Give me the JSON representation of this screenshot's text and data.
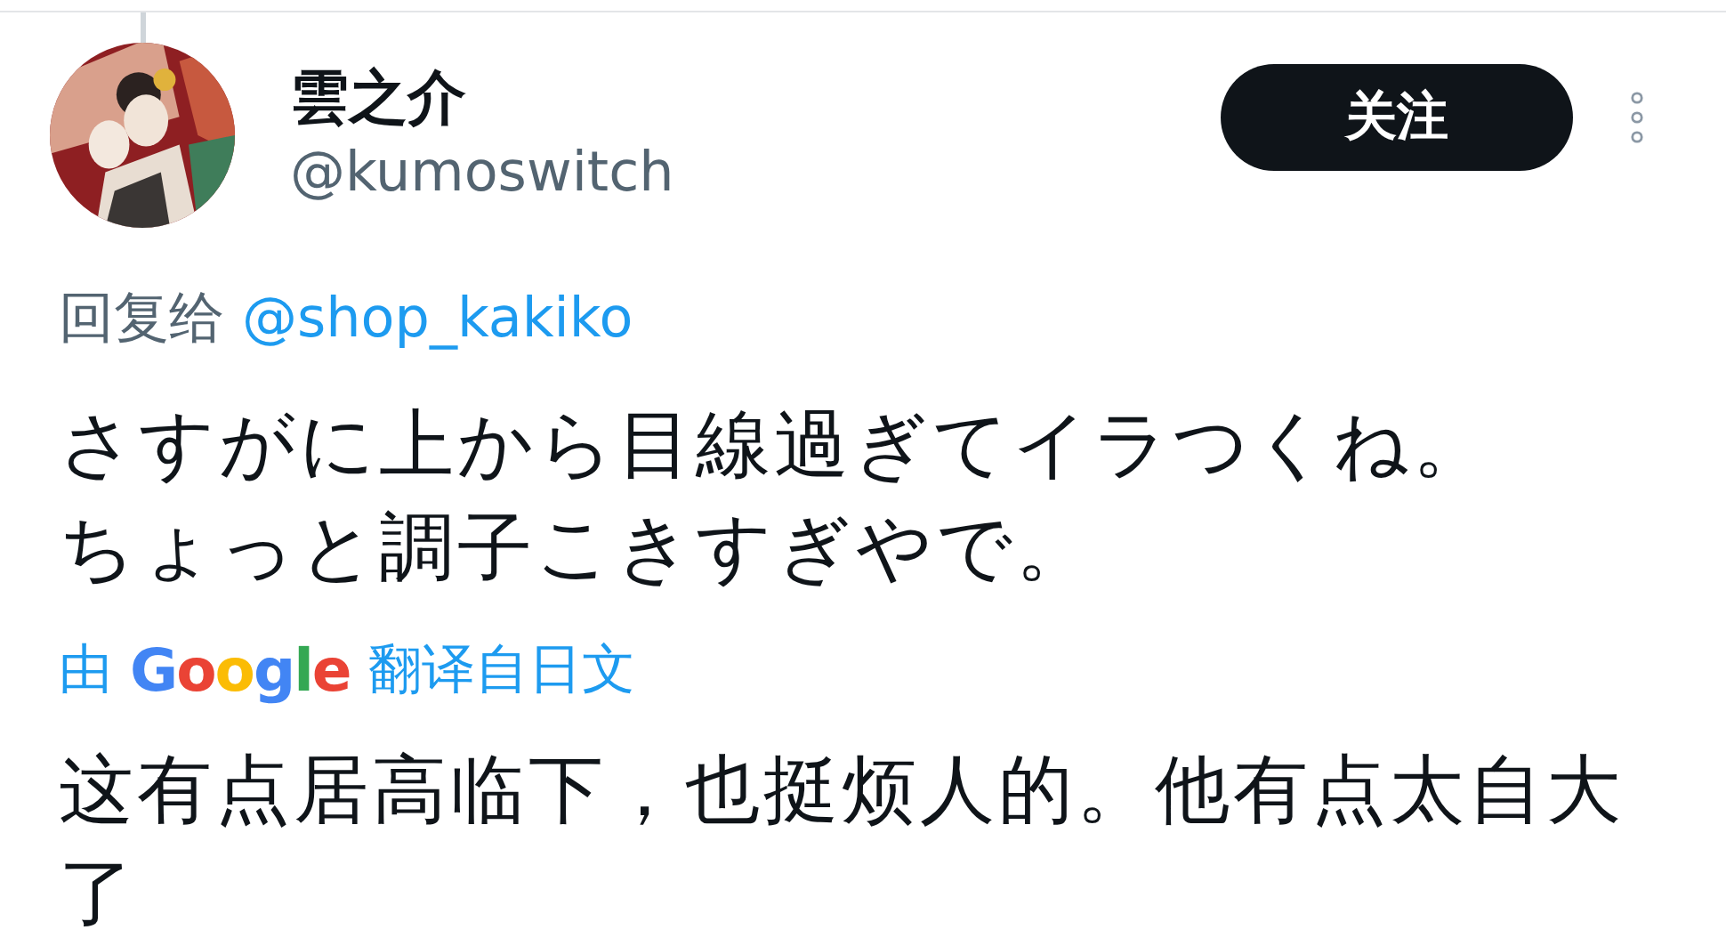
{
  "tweet": {
    "author": {
      "name": "雲之介",
      "handle": "@kumoswitch"
    },
    "follow_button": "关注",
    "reply_to": {
      "label": "回复给",
      "handle": "@shop_kakiko"
    },
    "text_lines": [
      "さすがに上から目線過ぎてイラつくね。",
      "ちょっと調子こきすぎやで。"
    ],
    "translation": {
      "prefix": "由",
      "brand": "Google",
      "suffix": "翻译自日文",
      "text": "这有点居高临下，也挺烦人的。他有点太自大了"
    }
  }
}
